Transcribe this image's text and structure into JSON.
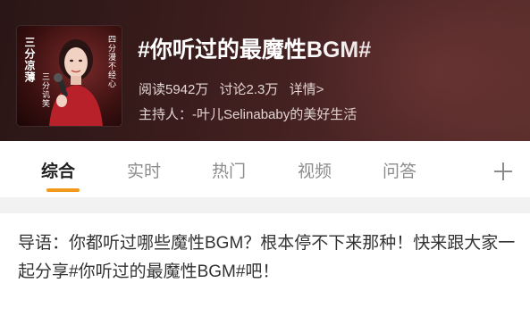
{
  "header": {
    "cover": {
      "text_left": "三分凉薄",
      "text_inner": "三分讥笑",
      "text_right": "四分漫不经心"
    },
    "title": "#你听过的最魔性BGM#",
    "stats": {
      "reads": "阅读5942万",
      "discussions": "讨论2.3万",
      "details": "详情>"
    },
    "host": "主持人：-叶儿Selinababy的美好生活"
  },
  "tabs": [
    {
      "label": "综合",
      "active": true
    },
    {
      "label": "实时",
      "active": false
    },
    {
      "label": "热门",
      "active": false
    },
    {
      "label": "视频",
      "active": false
    },
    {
      "label": "问答",
      "active": false
    }
  ],
  "tab_add_icon": "plus-icon",
  "intro": {
    "text": "导语：你都听过哪些魔性BGM？根本停不下来那种！快来跟大家一起分享#你听过的最魔性BGM#吧！"
  },
  "colors": {
    "header_bg": "#3a1c1c",
    "active_tab_underline": "#f39a1c",
    "active_tab_text": "#222222",
    "inactive_tab_text": "#8c8c8c"
  }
}
